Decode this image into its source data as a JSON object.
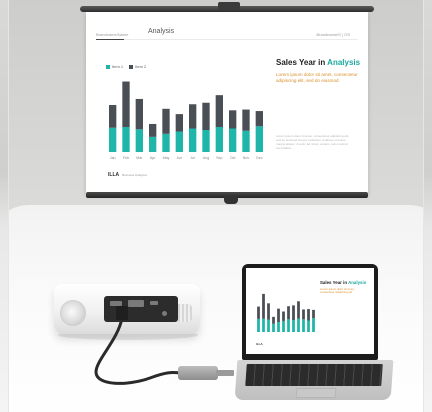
{
  "screen": {
    "brand_small": "Brandname/Name",
    "title": "Analysis",
    "top_right": "Brandname/S  |  OS",
    "legend": [
      "Item 1",
      "Item 2"
    ],
    "headline_plain": "Sales Year in",
    "headline_accent": "Analysis",
    "subtitle": "Lorem ipsum dolor sit amet, consectetur adipiscing elit, sed do eiusmod",
    "body_text": "Lorem ipsum dolor sit amet, consectetur adipiscing elit, sed do eiusmod tempor incididunt ut labore et dolore magna aliqua. Ut enim ad minim veniam, quis nostrud exercitation",
    "footer_brand": "ILLA",
    "footer_small": "Business Analytics"
  },
  "laptop": {
    "headline_plain": "Sales Year in",
    "headline_accent": "Analysis",
    "subtitle": "Lorem ipsum dolor sit amet, consectetur adipiscing elit",
    "footer_brand": "ILLA"
  },
  "colors": {
    "teal": "#1fb5a8",
    "dark": "#4a4e55",
    "accent_text": "#d9902c"
  },
  "chart_data": {
    "type": "bar",
    "categories": [
      "Jan",
      "Feb",
      "Mar",
      "Apr",
      "May",
      "Jun",
      "Jul",
      "Aug",
      "Sep",
      "Oct",
      "Nov",
      "Dec"
    ],
    "series": [
      {
        "name": "Item 1",
        "values": [
          32,
          33,
          30,
          20,
          24,
          27,
          31,
          29,
          33,
          31,
          28,
          34
        ]
      },
      {
        "name": "Item 2",
        "values": [
          30,
          60,
          40,
          17,
          33,
          23,
          32,
          36,
          42,
          24,
          28,
          20
        ]
      }
    ],
    "stacked": true
  }
}
